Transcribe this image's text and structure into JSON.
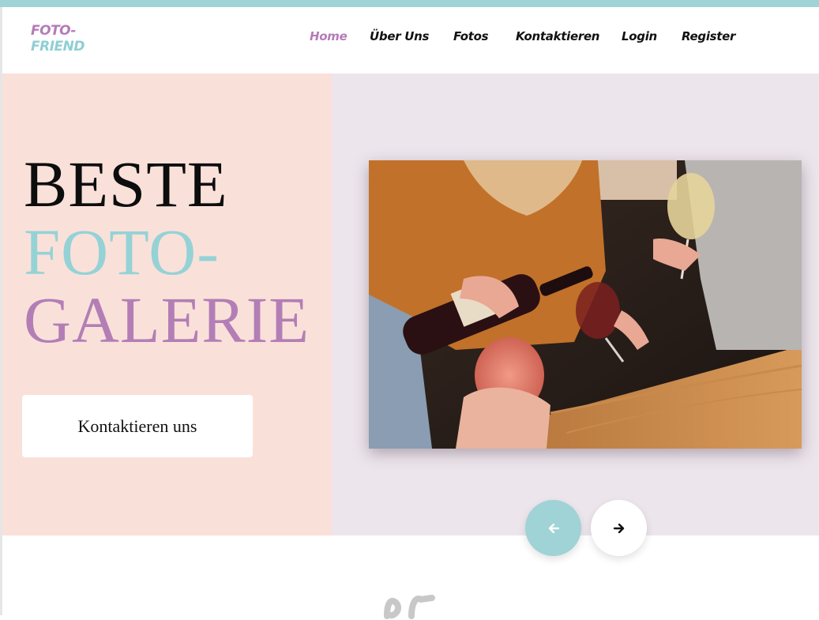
{
  "brand": {
    "line1": "FOTO-",
    "line2": "FRIEND"
  },
  "nav": {
    "items": [
      {
        "label": "Home",
        "active": true
      },
      {
        "label": "Über Uns"
      },
      {
        "label": "Fotos"
      },
      {
        "label": "Kontaktieren"
      },
      {
        "label": "Login"
      },
      {
        "label": "Register"
      }
    ]
  },
  "hero": {
    "headline": [
      "BESTE",
      "FOTO-",
      "GALERIE"
    ],
    "cta_label": "Kontaktieren uns"
  },
  "slider": {
    "prev_icon": "arrow-left-icon",
    "next_icon": "arrow-right-icon"
  },
  "colors": {
    "accent_teal": "#9fd3d6",
    "accent_purple": "#b57bb8",
    "hero_left_bg": "#f9e1da",
    "hero_right_bg": "#ede5ec"
  }
}
